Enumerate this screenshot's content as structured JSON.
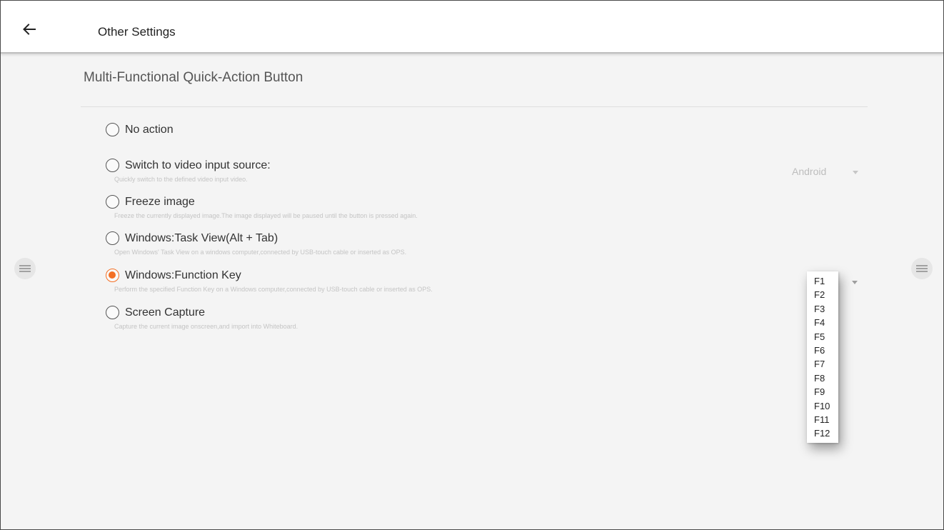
{
  "header": {
    "title": "Other Settings",
    "back_icon": "arrow-left-icon"
  },
  "section": {
    "title": "Multi-Functional Quick-Action Button"
  },
  "options": [
    {
      "label": "No action",
      "description": "",
      "checked": false
    },
    {
      "label": "Switch to video input source:",
      "description": "Quickly switch to the defined video input video.",
      "checked": false
    },
    {
      "label": "Freeze image",
      "description": "Freeze the currently displayed image.The image displayed will be paused until the button is pressed again.",
      "checked": false
    },
    {
      "label": "Windows:Task View(Alt + Tab)",
      "description": "Open Windows' Task View on a windows computer,connected by USB-touch cable or inserted as OPS.",
      "checked": false
    },
    {
      "label": "Windows:Function Key",
      "description": "Perform the specified Function Key on a Windows computer,connected by USB-touch cable or inserted as OPS.",
      "checked": true
    },
    {
      "label": "Screen Capture",
      "description": "Capture the current image onscreen,and import into Whiteboard.",
      "checked": false
    }
  ],
  "source_select": {
    "value": "Android",
    "icon": "caret-down-icon"
  },
  "function_key_dropdown": {
    "icon": "caret-down-icon",
    "items": [
      "F1",
      "F2",
      "F3",
      "F4",
      "F5",
      "F6",
      "F7",
      "F8",
      "F9",
      "F10",
      "F11",
      "F12"
    ]
  },
  "side_handles": {
    "icon": "menu-lines-icon"
  },
  "colors": {
    "accent": "#f36f24",
    "background": "#f4f4f4",
    "header": "#ffffff",
    "description_text": "#c4c4c4"
  }
}
